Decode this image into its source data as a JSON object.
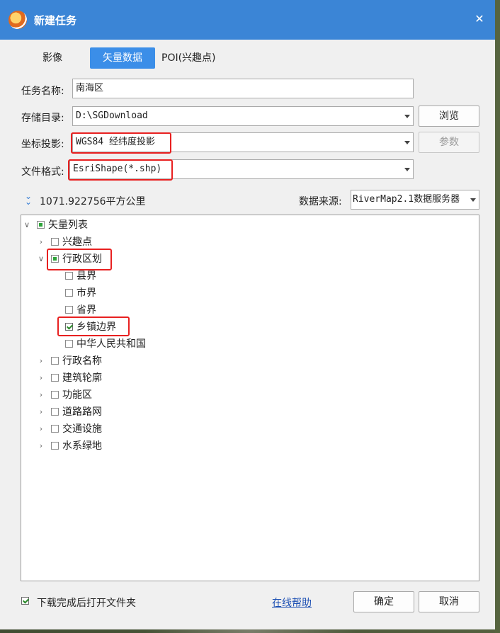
{
  "window": {
    "title": "新建任务"
  },
  "tabs": [
    {
      "label": "影像",
      "active": false
    },
    {
      "label": "矢量数据",
      "active": true
    },
    {
      "label": "POI(兴趣点)",
      "active": false
    }
  ],
  "form": {
    "task_name_label": "任务名称:",
    "task_name_value": "南海区",
    "save_dir_label": "存储目录:",
    "save_dir_value": "D:\\SGDownload",
    "browse_label": "浏览",
    "projection_label": "坐标投影:",
    "projection_value": "WGS84 经纬度投影",
    "params_label": "参数",
    "format_label": "文件格式:",
    "format_value": "EsriShape(*.shp)"
  },
  "info": {
    "area": "1071.922756平方公里",
    "source_label": "数据来源:",
    "source_value": "RiverMap2.1数据服务器"
  },
  "tree": {
    "root": "矢量列表",
    "items": [
      "兴趣点",
      "行政区划",
      "县界",
      "市界",
      "省界",
      "乡镇边界",
      "中华人民共和国",
      "行政名称",
      "建筑轮廓",
      "功能区",
      "道路路网",
      "交通设施",
      "水系绿地"
    ]
  },
  "footer": {
    "open_folder_label": "下载完成后打开文件夹",
    "help_link": "在线帮助",
    "ok_label": "确定",
    "cancel_label": "取消"
  },
  "colors": {
    "titlebar": "#3b85d6",
    "active_tab": "#3b8ee8",
    "highlight": "#e82020"
  }
}
